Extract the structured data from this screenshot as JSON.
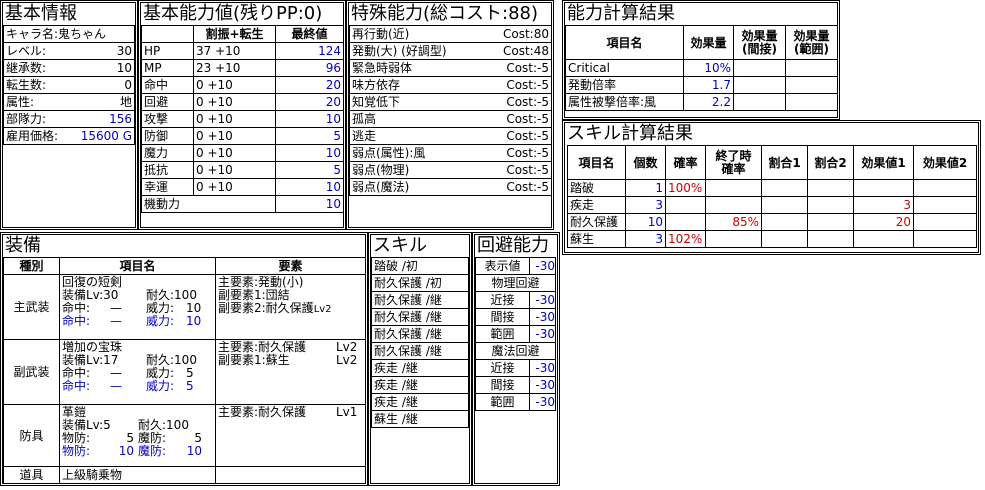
{
  "chara": {
    "title": "基本情報",
    "rows": [
      {
        "label": "キャラ名:鬼ちゃん",
        "value": ""
      },
      {
        "label": "レベル:",
        "value": "30"
      },
      {
        "label": "継承数:",
        "value": "10"
      },
      {
        "label": "転生数:",
        "value": "0"
      },
      {
        "label": "属性:",
        "value": "地"
      },
      {
        "label": "部隊力:",
        "value": "156"
      },
      {
        "label": "雇用価格:",
        "value": "15600 G"
      }
    ]
  },
  "stats": {
    "title": "基本能力値(残りPP:0)",
    "headers": [
      "割振+転生",
      "最終値"
    ],
    "rows": [
      {
        "name": "HP",
        "alloc": "37 +10",
        "final": "124"
      },
      {
        "name": "MP",
        "alloc": "23 +10",
        "final": "96"
      },
      {
        "name": "命中",
        "alloc": "0 +10",
        "final": "20"
      },
      {
        "name": "回避",
        "alloc": "0 +10",
        "final": "20"
      },
      {
        "name": "攻撃",
        "alloc": "0 +10",
        "final": "10"
      },
      {
        "name": "防御",
        "alloc": "0 +10",
        "final": "5"
      },
      {
        "name": "魔力",
        "alloc": "0 +10",
        "final": "10"
      },
      {
        "name": "抵抗",
        "alloc": "0 +10",
        "final": "5"
      },
      {
        "name": "幸運",
        "alloc": "0 +10",
        "final": "10"
      },
      {
        "name": "機動力",
        "alloc": "",
        "final": "10"
      }
    ]
  },
  "special": {
    "title": "特殊能力(総コスト:88)",
    "rows": [
      {
        "name": "再行動(近)",
        "cost": "Cost:80"
      },
      {
        "name": "発動(大) (好調型)",
        "cost": "Cost:48"
      },
      {
        "name": "緊急時弱体",
        "cost": "Cost:-5"
      },
      {
        "name": "味方依存",
        "cost": "Cost:-5"
      },
      {
        "name": "知覚低下",
        "cost": "Cost:-5"
      },
      {
        "name": "孤高",
        "cost": "Cost:-5"
      },
      {
        "name": "逃走",
        "cost": "Cost:-5"
      },
      {
        "name": "弱点(属性):風",
        "cost": "Cost:-5"
      },
      {
        "name": "弱点(物理)",
        "cost": "Cost:-5"
      },
      {
        "name": "弱点(魔法)",
        "cost": "Cost:-5"
      }
    ]
  },
  "ability_calc": {
    "title": "能力計算結果",
    "headers": [
      "項目名",
      "効果量",
      "効果量\n(間接)",
      "効果量\n(範囲)"
    ],
    "rows": [
      {
        "name": "Critical",
        "v1": "10%",
        "v2": "",
        "v3": ""
      },
      {
        "name": "発動倍率",
        "v1": "1.7",
        "v2": "",
        "v3": ""
      },
      {
        "name": "属性被撃倍率:風",
        "v1": "2.2",
        "v2": "",
        "v3": ""
      }
    ]
  },
  "skill_calc": {
    "title": "スキル計算結果",
    "headers": [
      "項目名",
      "個数",
      "確率",
      "終了時\n確率",
      "割合1",
      "割合2",
      "効果値1",
      "効果値2"
    ],
    "rows": [
      {
        "name": "踏破",
        "count": "1",
        "rate": "100%",
        "end": "",
        "r1": "",
        "r2": "",
        "e1": "",
        "e2": ""
      },
      {
        "name": "疾走",
        "count": "3",
        "rate": "",
        "end": "",
        "r1": "",
        "r2": "",
        "e1": "3",
        "e2": ""
      },
      {
        "name": "耐久保護",
        "count": "10",
        "rate": "",
        "end": "85%",
        "r1": "",
        "r2": "",
        "e1": "20",
        "e2": ""
      },
      {
        "name": "蘇生",
        "count": "3",
        "rate": "102%",
        "end": "",
        "r1": "",
        "r2": "",
        "e1": "",
        "e2": ""
      }
    ]
  },
  "equipment": {
    "title": "装備",
    "headers": [
      "種別",
      "項目名",
      "要素"
    ],
    "main_weapon": {
      "type": "主武装",
      "name": "回復の短剣",
      "equip_lv": "装備Lv:30",
      "durability": "耐久:100",
      "hit_label": "命中:",
      "hit_value": "—",
      "power_label": "威力:",
      "power_value": "10",
      "eff_hit_label": "命中:",
      "eff_hit_value": "—",
      "eff_power_label": "威力:",
      "eff_power_value": "10",
      "elements": [
        "主要素:発動(小)",
        "副要素1:団結",
        "副要素2:耐久保護"
      ],
      "element_lv": "Lv2"
    },
    "sub_weapon": {
      "type": "副武装",
      "name": "増加の宝珠",
      "equip_lv": "装備Lv:17",
      "durability": "耐久:100",
      "hit_label": "命中:",
      "hit_value": "—",
      "power_label": "威力:",
      "power_value": "5",
      "eff_hit_label": "命中:",
      "eff_hit_value": "—",
      "eff_power_label": "威力:",
      "eff_power_value": "5",
      "elements": [
        "主要素:耐久保護",
        "副要素1:蘇生"
      ],
      "element_lvs": [
        "Lv2",
        "Lv2"
      ]
    },
    "armor": {
      "type": "防具",
      "name": "革鎧",
      "equip_lv": "装備Lv:5",
      "durability": "耐久:100",
      "phys_label": "物防:",
      "phys_value": "5",
      "mag_label": "魔防:",
      "mag_value": "5",
      "eff_phys_label": "物防:",
      "eff_phys_value": "10",
      "eff_mag_label": "魔防:",
      "eff_mag_value": "10",
      "elements": [
        "主要素:耐久保護"
      ],
      "element_lv": "Lv1"
    },
    "tool": {
      "type": "道具",
      "name": "上級騎乗物",
      "elements": []
    }
  },
  "skills": {
    "title": "スキル",
    "items": [
      "踏破 /初",
      "耐久保護 /初",
      "耐久保護 /継",
      "耐久保護 /継",
      "耐久保護 /継",
      "耐久保護 /継",
      "疾走 /継",
      "疾走 /継",
      "疾走 /継",
      "蘇生 /継"
    ]
  },
  "evasion": {
    "title": "回避能力",
    "display_label": "表示値",
    "display_value": "-30",
    "physical_label": "物理回避",
    "physical": [
      {
        "label": "近接",
        "value": "-30"
      },
      {
        "label": "間接",
        "value": "-30"
      },
      {
        "label": "範囲",
        "value": "-30"
      }
    ],
    "magic_label": "魔法回避",
    "magic": [
      {
        "label": "近接",
        "value": "-30"
      },
      {
        "label": "間接",
        "value": "-30"
      },
      {
        "label": "範囲",
        "value": "-30"
      }
    ]
  },
  "colors": {
    "accent_blue": "#0000c8",
    "accent_red": "#d20000",
    "border": "#000000"
  }
}
